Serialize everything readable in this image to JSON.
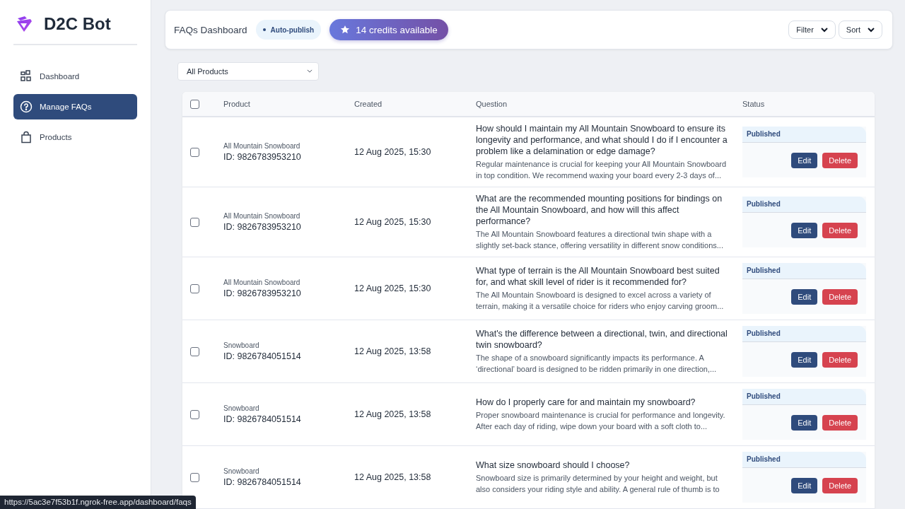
{
  "sidebar": {
    "brand": "D2C Bot",
    "items": [
      {
        "label": "Dashboard",
        "selected": false
      },
      {
        "label": "Manage FAQs",
        "selected": true
      },
      {
        "label": "Products",
        "selected": false
      }
    ]
  },
  "header": {
    "title": "FAQs Dashboard",
    "badge": "Auto-publish",
    "credits": "14 credits available",
    "buttons": [
      "Filter",
      "Sort"
    ]
  },
  "product_filter": {
    "value": "All Products"
  },
  "table": {
    "select_all": {
      "checked": false
    },
    "columns": [
      "Product",
      "Created",
      "Question",
      "Status"
    ],
    "rows": [
      {
        "checked": false,
        "product": "All Mountain Snowboard",
        "product_id": "ID: 9826783953210",
        "created": "12 Aug 2025, 15:30",
        "question": "How should I maintain my All Mountain Snowboard to ensure its longevity and performance, and what should I do if I encounter a problem like a delamination or edge damage?",
        "answer": "Regular maintenance is crucial for keeping your All Mountain Snowboard in top condition. We recommend waxing your board every 2-3 days of...",
        "status": "Published",
        "actions": [
          {
            "label": "Edit",
            "kind": "primary"
          },
          {
            "label": "Delete",
            "kind": "danger"
          }
        ]
      },
      {
        "checked": false,
        "product": "All Mountain Snowboard",
        "product_id": "ID: 9826783953210",
        "created": "12 Aug 2025, 15:30",
        "question": "What are the recommended mounting positions for bindings on the All Mountain Snowboard, and how will this affect performance?",
        "answer": "The All Mountain Snowboard features a directional twin shape with a slightly set-back stance, offering versatility in different snow conditions...",
        "status": "Published",
        "actions": [
          {
            "label": "Edit",
            "kind": "primary"
          },
          {
            "label": "Delete",
            "kind": "danger"
          }
        ]
      },
      {
        "checked": false,
        "product": "All Mountain Snowboard",
        "product_id": "ID: 9826783953210",
        "created": "12 Aug 2025, 15:30",
        "question": "What type of terrain is the All Mountain Snowboard best suited for, and what skill level of rider is it recommended for?",
        "answer": "The All Mountain Snowboard is designed to excel across a variety of terrain, making it a versatile choice for riders who enjoy carving groom...",
        "status": "Published",
        "actions": [
          {
            "label": "Edit",
            "kind": "primary"
          },
          {
            "label": "Delete",
            "kind": "danger"
          }
        ]
      },
      {
        "checked": false,
        "product": "Snowboard",
        "product_id": "ID: 9826784051514",
        "created": "12 Aug 2025, 13:58",
        "question": "What's the difference between a directional, twin, and directional twin snowboard?",
        "answer": "The shape of a snowboard significantly impacts its performance. A ‘directional’ board is designed to be ridden primarily in one direction,...",
        "status": "Published",
        "actions": [
          {
            "label": "Edit",
            "kind": "primary"
          },
          {
            "label": "Delete",
            "kind": "danger"
          }
        ]
      },
      {
        "checked": false,
        "product": "Snowboard",
        "product_id": "ID: 9826784051514",
        "created": "12 Aug 2025, 13:58",
        "question": "How do I properly care for and maintain my snowboard?",
        "answer": "Proper snowboard maintenance is crucial for performance and longevity. After each day of riding, wipe down your board with a soft cloth to...",
        "status": "Published",
        "actions": [
          {
            "label": "Edit",
            "kind": "primary"
          },
          {
            "label": "Delete",
            "kind": "danger"
          }
        ]
      },
      {
        "checked": false,
        "product": "Snowboard",
        "product_id": "ID: 9826784051514",
        "created": "12 Aug 2025, 13:58",
        "question": "What size snowboard should I choose?",
        "answer": "Snowboard size is primarily determined by your height and weight, but also considers your riding style and ability. A general rule of thumb is to",
        "status": "Published",
        "actions": [
          {
            "label": "Edit",
            "kind": "primary"
          },
          {
            "label": "Delete",
            "kind": "danger"
          }
        ]
      }
    ]
  },
  "status_bar": {
    "url": "https://5ac3e7f53b1f.ngrok-free.app/dashboard/faqs"
  }
}
